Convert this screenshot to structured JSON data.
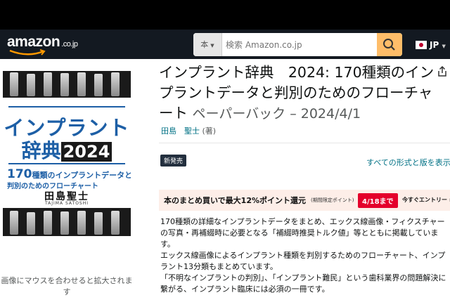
{
  "header": {
    "logo_text": "amazon",
    "logo_tld": ".co.jp",
    "search": {
      "category_label": "本",
      "placeholder": "検索 Amazon.co.jp"
    },
    "language": "JP",
    "colors": {
      "nav_bg": "#131921",
      "search_button": "#febd69",
      "smile": "#ff9900"
    }
  },
  "product": {
    "cover": {
      "title_line1": "インプラント",
      "title_line2": "辞典",
      "title_year": "2024",
      "subtitle_num": "170",
      "subtitle_line1": "種類のインプラントデータと",
      "subtitle_line2": "判別のためのフローチャート",
      "author": "田島聖士",
      "author_roman": "TAJIMA SATOSHI"
    },
    "image_hint": "画像にマウスを合わせると拡大されます",
    "title": "インプラント辞典　2024: 170種類のインプラントデータと判別のためのフローチャート",
    "format_date": "ペーパーバック – 2024/4/1",
    "author_name": "田島　聖士",
    "author_role": "(著)",
    "badge": "新発売",
    "all_formats_link": "すべての形式と版を表示",
    "promo": {
      "text": "本のまとめ買いで最大12%ポイント還元",
      "small": "(期間限定ポイント)",
      "deadline": "4/18まで",
      "entry": "今すぐエントリー ›",
      "colors": {
        "bg": "#fdeee8",
        "deadline_bg": "#e4002b"
      }
    },
    "description": [
      "170種類の詳細なインプラントデータをまとめ、エックス線画像・フィクスチャーの写真・再補綴時に必要となる「補綴時推奨トルク値」等とともに掲載しています。",
      "エックス線画像によるインプラント種類を判別するためのフローチャート、インプラント13分類もまとめています。",
      "「不明なインプラントの判別」、「インプラント難民」という歯科業界の問題解決に繋がる、インプラント臨床には必須の一冊です。"
    ]
  }
}
